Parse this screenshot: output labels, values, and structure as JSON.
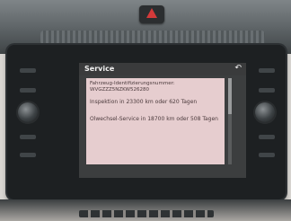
{
  "screen": {
    "title": "Service",
    "back_icon": "back-arrow-icon"
  },
  "info": {
    "vin_label": "Fahrzeug-Identifizierungsnummer:",
    "vin_value": "WVGZZZ5NZKW526280",
    "inspection": "Inspektion in 23300 km oder 620 Tagen",
    "oil_service": "Ölwechsel-Service in 18700 km oder 508 Tagen"
  },
  "colors": {
    "panel": "#e6cdcf",
    "hazard": "#d33a3a"
  }
}
